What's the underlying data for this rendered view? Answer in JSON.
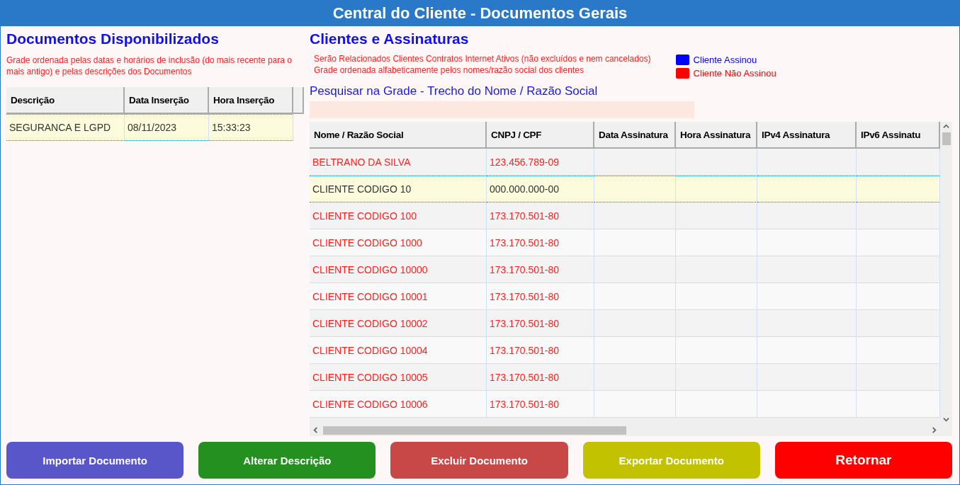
{
  "window": {
    "title": "Central do Cliente - Documentos Gerais"
  },
  "documents": {
    "title": "Documentos Disponibilizados",
    "note": "Grade ordenada pelas datas e horários de inclusão (do mais recente para o mais antigo) e pelas descrições dos Documentos",
    "columns": [
      "Descrição",
      "Data Inserção",
      "Hora Inserção"
    ],
    "rows": [
      {
        "cells": [
          "SEGURANCA E LGPD",
          "08/11/2023",
          "15:33:23"
        ],
        "selected": true
      }
    ]
  },
  "clients": {
    "title": "Clientes e Assinaturas",
    "notes": [
      "Serão Relacionados Clientes Contratos Internet Ativos (não excluídos e nem cancelados)",
      "Grade ordenada alfabeticamente pelos nomes/razão social dos clientes"
    ],
    "legend": [
      {
        "label": "Cliente Assinou",
        "color": "#0000ff"
      },
      {
        "label": "Cliente Não Assinou",
        "color": "#ff0000"
      }
    ],
    "search": {
      "label": "Pesquisar na Grade - Trecho do Nome / Razão Social"
    },
    "columns": [
      "Nome / Razão Social",
      "CNPJ / CPF",
      "Data Assinatura",
      "Hora Assinatura",
      "IPv4 Assinatura",
      "IPv6 Assinatu"
    ],
    "rows": [
      {
        "name": "BELTRANO DA SILVA",
        "doc": "123.456.789-09",
        "signed": false,
        "selected": false
      },
      {
        "name": "CLIENTE CODIGO 10",
        "doc": "000.000.000-00",
        "selected": true
      },
      {
        "name": "CLIENTE CODIGO 100",
        "doc": "173.170.501-80",
        "signed": false,
        "selected": false
      },
      {
        "name": "CLIENTE CODIGO 1000",
        "doc": "173.170.501-80",
        "signed": false,
        "selected": false
      },
      {
        "name": "CLIENTE CODIGO 10000",
        "doc": "173.170.501-80",
        "signed": false,
        "selected": false
      },
      {
        "name": "CLIENTE CODIGO 10001",
        "doc": "173.170.501-80",
        "signed": false,
        "selected": false
      },
      {
        "name": "CLIENTE CODIGO 10002",
        "doc": "173.170.501-80",
        "signed": false,
        "selected": false
      },
      {
        "name": "CLIENTE CODIGO 10004",
        "doc": "173.170.501-80",
        "signed": false,
        "selected": false
      },
      {
        "name": "CLIENTE CODIGO 10005",
        "doc": "173.170.501-80",
        "signed": false,
        "selected": false
      },
      {
        "name": "CLIENTE CODIGO 10006",
        "doc": "173.170.501-80",
        "signed": false,
        "selected": false
      }
    ]
  },
  "buttons": [
    {
      "label": "Importar Documento",
      "color": "#5856c8"
    },
    {
      "label": "Alterar Descrição",
      "color": "#23901f"
    },
    {
      "label": "Excluir Documento",
      "color": "#c84848"
    },
    {
      "label": "Exportar Documento",
      "color": "#c2c200"
    },
    {
      "label": "Retornar",
      "color": "#ff0000"
    }
  ]
}
